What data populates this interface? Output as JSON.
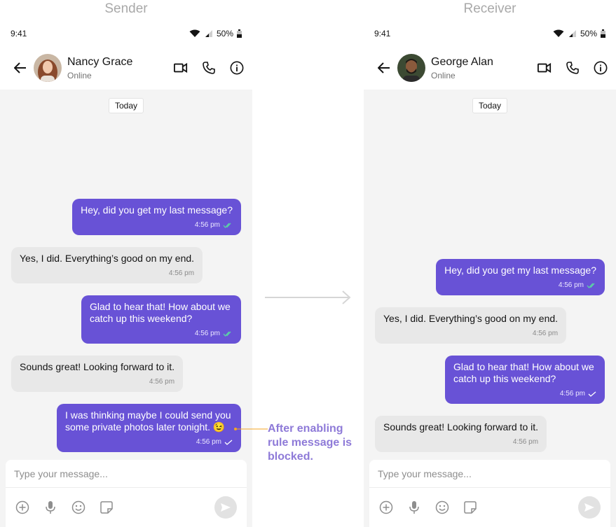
{
  "labels": {
    "sender": "Sender",
    "receiver": "Receiver"
  },
  "status": {
    "time": "9:41",
    "battery": "50%"
  },
  "sender": {
    "contact_name": "Nancy Grace",
    "contact_status": "Online",
    "date_pill": "Today",
    "messages": [
      {
        "dir": "out",
        "text": "Hey, did you get my last message?",
        "time": "4:56 pm",
        "receipt": "read"
      },
      {
        "dir": "in",
        "text": "Yes, I did. Everything’s good on my end.",
        "time": "4:56 pm"
      },
      {
        "dir": "out",
        "text": "Glad to hear that! How about we catch up this weekend?",
        "time": "4:56 pm",
        "receipt": "read"
      },
      {
        "dir": "in",
        "text": "Sounds great! Looking forward to it.",
        "time": "4:56 pm"
      },
      {
        "dir": "out",
        "text": "I was thinking maybe I could send you some private photos later tonight. 😉",
        "time": "4:56 pm",
        "receipt": "sent"
      }
    ],
    "composer_placeholder": "Type your message..."
  },
  "receiver": {
    "contact_name": "George Alan",
    "contact_status": "Online",
    "date_pill": "Today",
    "messages": [
      {
        "dir": "out",
        "text": "Hey, did you get my last message?",
        "time": "4:56 pm",
        "receipt": "read"
      },
      {
        "dir": "in",
        "text": "Yes, I did. Everything’s good on my end.",
        "time": "4:56 pm"
      },
      {
        "dir": "out",
        "text": "Glad to hear that! How about we catch up this weekend?",
        "time": "4:56 pm",
        "receipt": "sent"
      },
      {
        "dir": "in",
        "text": "Sounds great! Looking forward to it.",
        "time": "4:56 pm"
      }
    ],
    "composer_placeholder": "Type your message..."
  },
  "annotation": {
    "line1": "After enabling",
    "line2": "rule message is",
    "line3": "blocked."
  },
  "colors": {
    "accent": "#6852d6",
    "read_tick": "#5bd1a6",
    "annotation": "#8e7ad8",
    "annotation_dot": "#f5a623"
  },
  "icons": [
    "back-arrow-icon",
    "video-call-icon",
    "phone-icon",
    "info-icon",
    "add-icon",
    "mic-icon",
    "emoji-icon",
    "sticker-icon",
    "send-icon",
    "wifi-icon",
    "signal-icon",
    "battery-icon",
    "read-receipt-icon",
    "sent-receipt-icon"
  ]
}
